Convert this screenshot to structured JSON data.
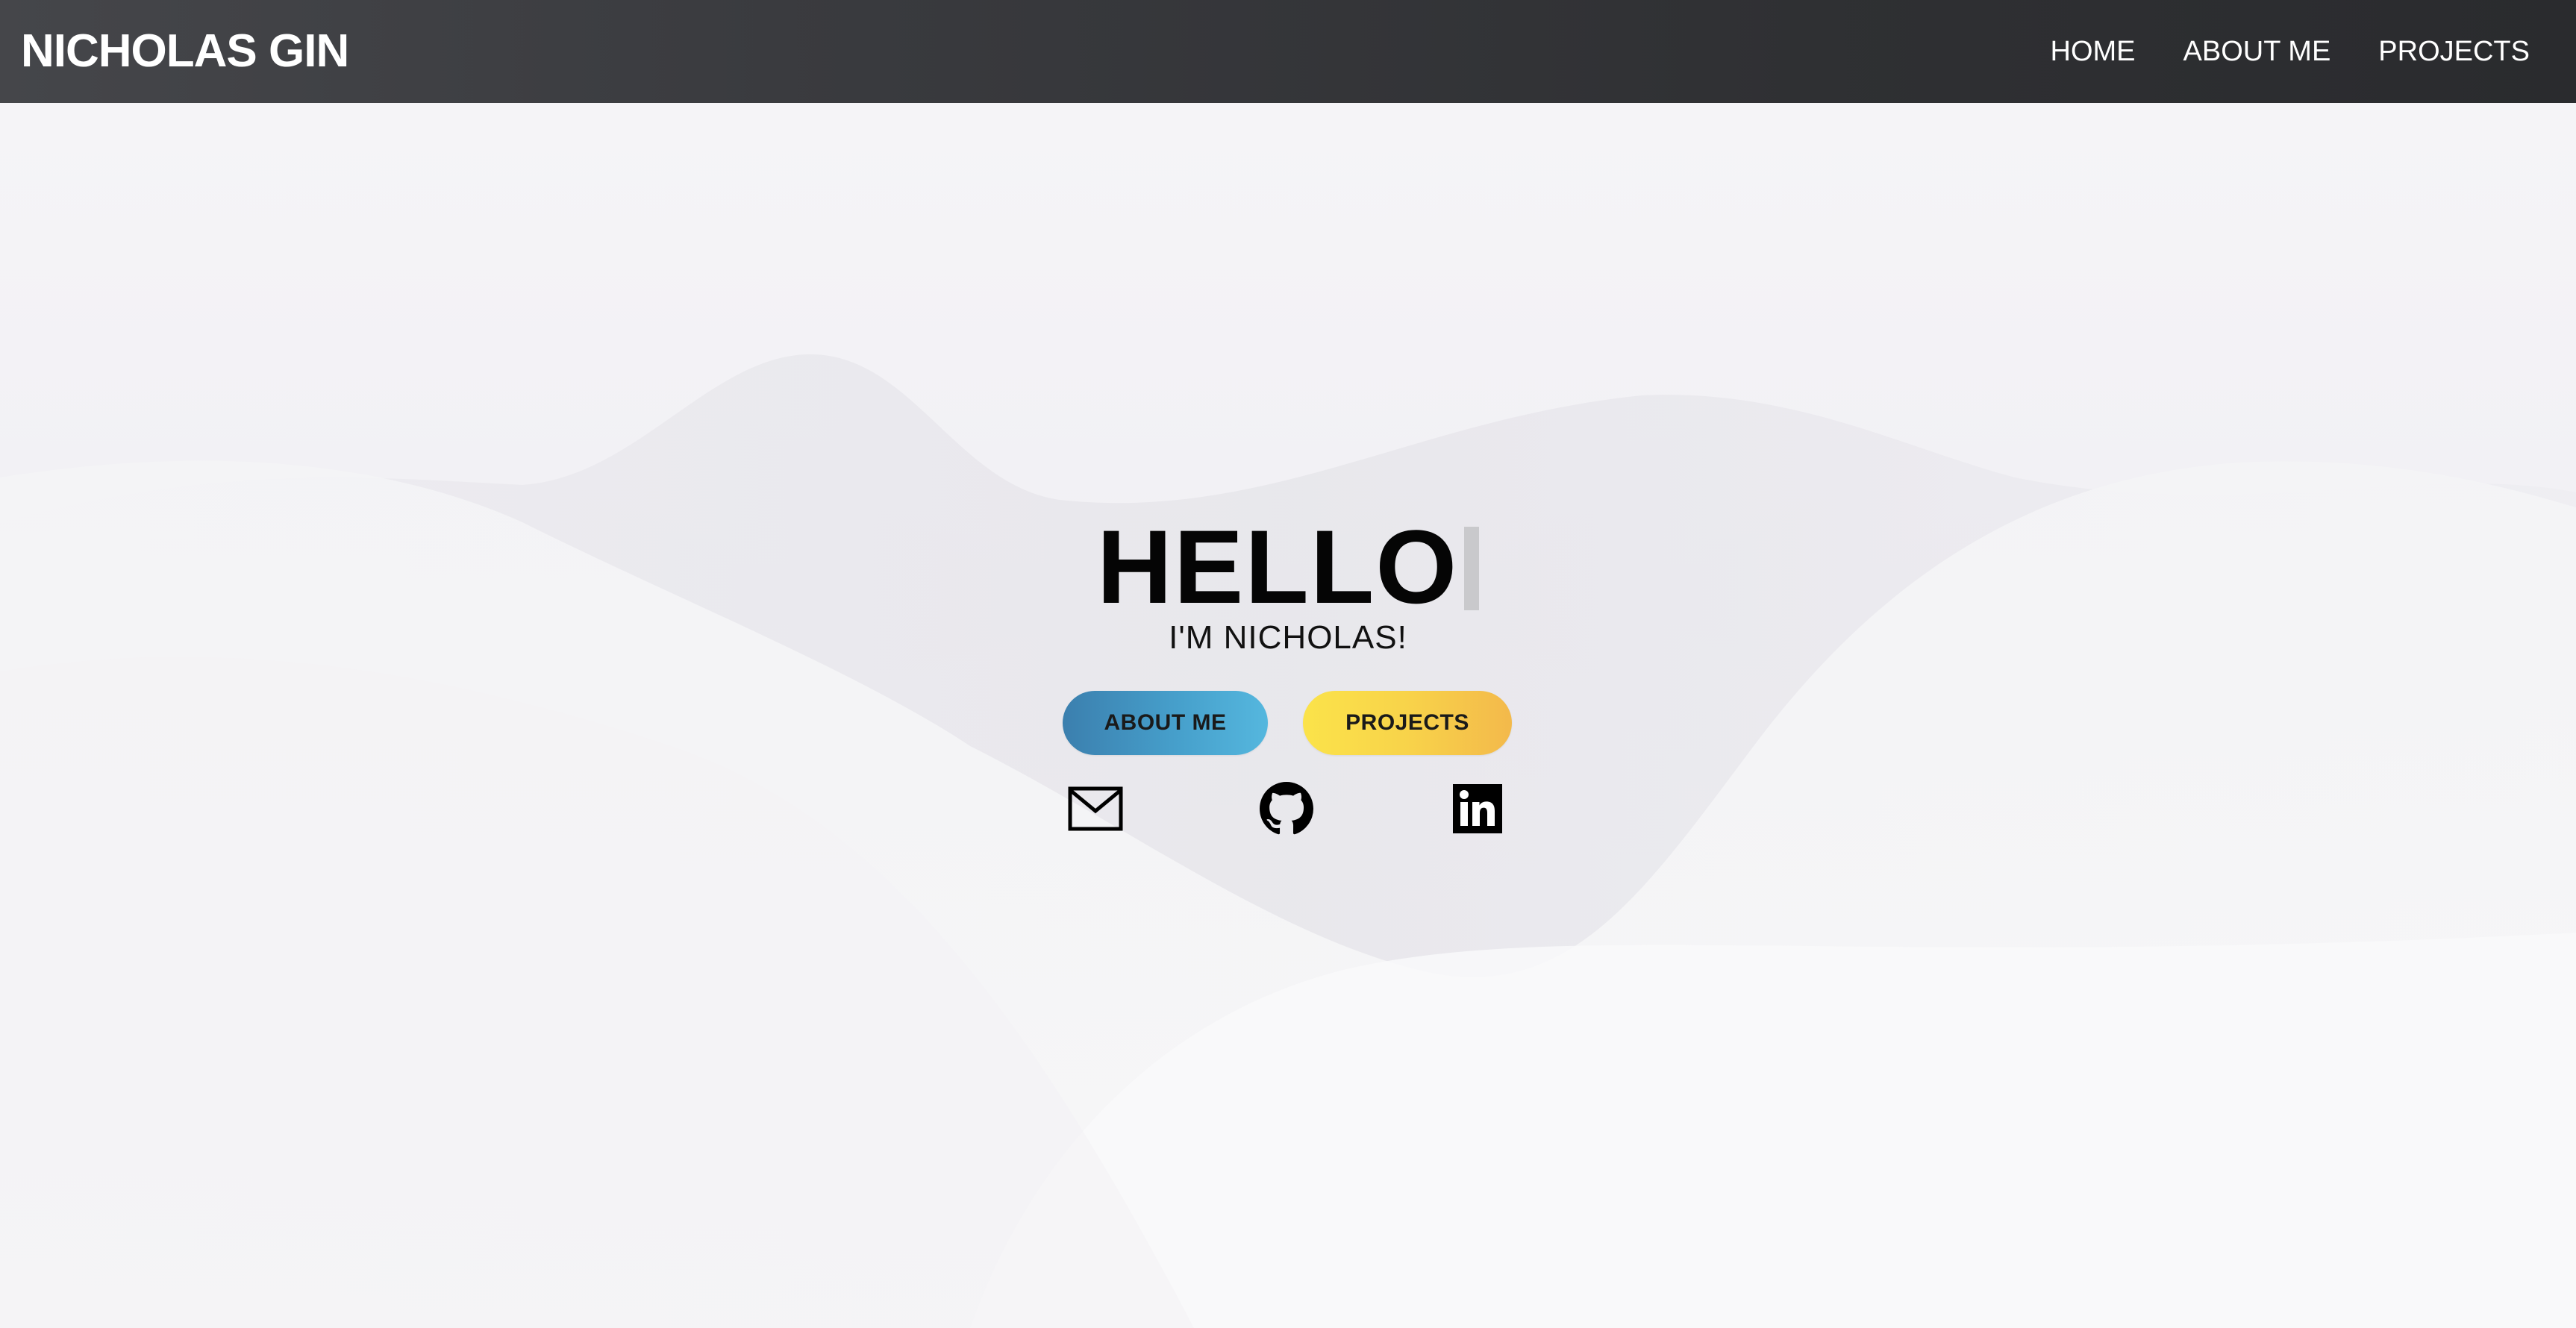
{
  "brand": {
    "name": "NICHOLAS GIN"
  },
  "nav": {
    "items": [
      {
        "label": "HOME"
      },
      {
        "label": "ABOUT ME"
      },
      {
        "label": "PROJECTS"
      }
    ]
  },
  "hero": {
    "greeting": "HELLO",
    "subtitle": "I'M NICHOLAS!",
    "buttons": {
      "about": "ABOUT ME",
      "projects": "PROJECTS"
    },
    "social": [
      {
        "icon": "mail-icon"
      },
      {
        "icon": "github-icon"
      },
      {
        "icon": "linkedin-icon"
      }
    ]
  },
  "colors": {
    "navbar": "#2f3033",
    "about_button": "#469fcb",
    "projects_button": "#f8d34a",
    "text_dark": "#050505"
  }
}
